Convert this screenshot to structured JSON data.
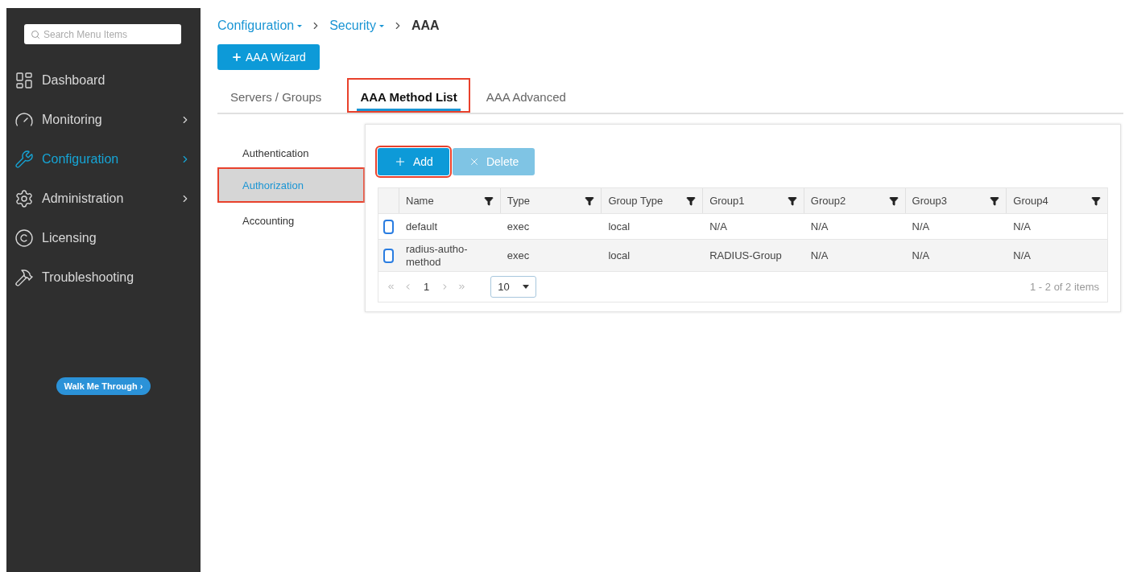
{
  "sidebar": {
    "search": {
      "placeholder": "Search Menu Items"
    },
    "items": [
      {
        "kind": "dashboard",
        "label": "Dashboard",
        "selected": false,
        "has_submenu": false
      },
      {
        "kind": "monitoring",
        "label": "Monitoring",
        "selected": false,
        "has_submenu": true
      },
      {
        "kind": "configuration",
        "label": "Configuration",
        "selected": true,
        "has_submenu": true
      },
      {
        "kind": "administration",
        "label": "Administration",
        "selected": false,
        "has_submenu": true
      },
      {
        "kind": "licensing",
        "label": "Licensing",
        "selected": false,
        "has_submenu": false
      },
      {
        "kind": "troubleshooting",
        "label": "Troubleshooting",
        "selected": false,
        "has_submenu": false
      }
    ],
    "walk_button": "Walk Me Through ›"
  },
  "breadcrumb": {
    "links": [
      {
        "label": "Configuration"
      },
      {
        "label": "Security"
      }
    ],
    "current": "AAA"
  },
  "wizard_button": "AAA Wizard",
  "tabs": [
    {
      "label": "Servers / Groups",
      "selected": false,
      "highlighted": false
    },
    {
      "label": "AAA Method List",
      "selected": true,
      "highlighted": true
    },
    {
      "label": "AAA Advanced",
      "selected": false,
      "highlighted": false
    }
  ],
  "subnav": [
    {
      "label": "Authentication",
      "selected": false,
      "highlighted": false
    },
    {
      "label": "Authorization",
      "selected": true,
      "highlighted": true
    },
    {
      "label": "Accounting",
      "selected": false,
      "highlighted": false
    }
  ],
  "toolbar": {
    "add": {
      "label": "Add",
      "highlighted": true,
      "disabled": false
    },
    "delete": {
      "label": "Delete",
      "disabled": true
    }
  },
  "table": {
    "columns": [
      "Name",
      "Type",
      "Group Type",
      "Group1",
      "Group2",
      "Group3",
      "Group4"
    ],
    "rows": [
      {
        "checked": false,
        "cells": [
          "default",
          "exec",
          "local",
          "N/A",
          "N/A",
          "N/A",
          "N/A"
        ]
      },
      {
        "checked": false,
        "cells": [
          "radius-autho-method",
          "exec",
          "local",
          "RADIUS-Group",
          "N/A",
          "N/A",
          "N/A"
        ]
      }
    ],
    "pager": {
      "page": "1",
      "page_size": "10",
      "summary": "1 - 2 of 2 items"
    }
  }
}
